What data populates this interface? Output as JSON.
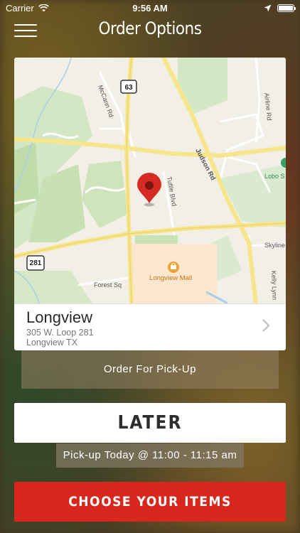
{
  "status": {
    "carrier": "Carrier",
    "time": "9:56 AM",
    "battery_level": 1.0
  },
  "nav": {
    "title": "Order Options",
    "menu_icon": "hamburger-icon"
  },
  "map": {
    "highway_63": "63",
    "highway_281": "281",
    "road_mccann": "McCann Rd",
    "road_judson": "Judson Rd",
    "road_tuttle": "Tuttle Blvd",
    "road_airline": "Airline Rd",
    "road_skyline": "Skyline",
    "road_forest": "Forest Sq",
    "road_kelly": "Kelly Lynn",
    "poi_lobo": "Lobo S",
    "poi_mall": "Longview Mall"
  },
  "location": {
    "name": "Longview",
    "address_line1": "305 W. Loop 281",
    "address_line2": "Longview TX"
  },
  "order_type_label": "Order For Pick-Up",
  "timing_label": "LATER",
  "pickup_time_label": "Pick-up Today @ 11:00 - 11:15 am",
  "cta_label": "CHOOSE YOUR ITEMS",
  "colors": {
    "accent": "#d8271d",
    "map_land": "#f2efe6",
    "map_park": "#cfe6c0",
    "map_road": "#f7e89a"
  }
}
